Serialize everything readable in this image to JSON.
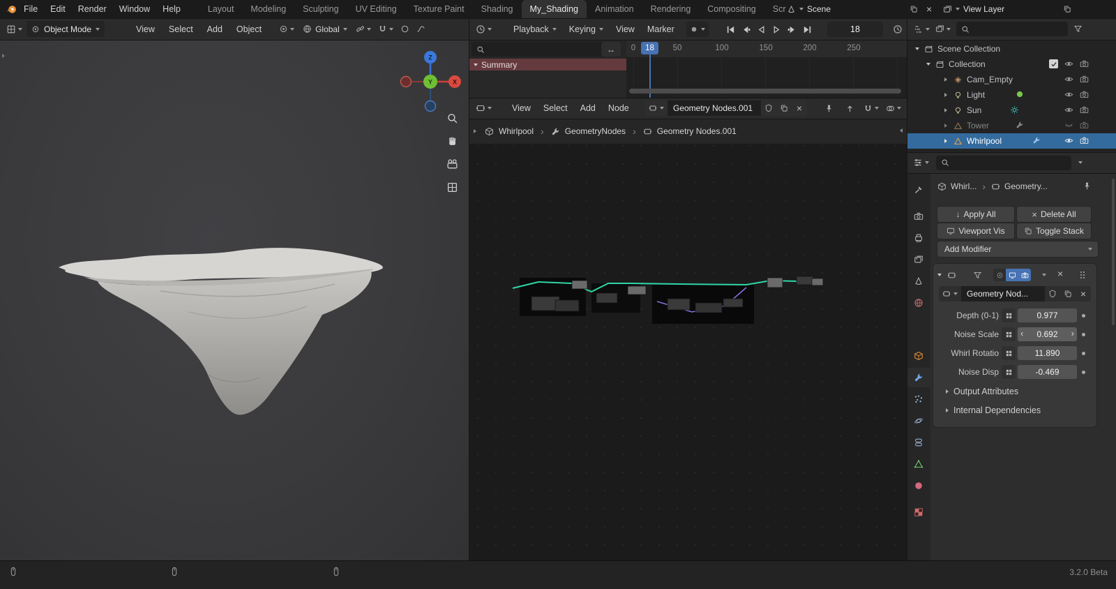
{
  "glyphs": {
    "chevron_right": "›",
    "chevron_left": "‹",
    "close": "×",
    "down_arrow": "↓",
    "swap": "↔"
  },
  "topbar": {
    "menus": [
      "File",
      "Edit",
      "Render",
      "Window",
      "Help"
    ],
    "tabs": [
      "Layout",
      "Modeling",
      "Sculpting",
      "UV Editing",
      "Texture Paint",
      "Shading",
      "My_Shading",
      "Animation",
      "Rendering",
      "Compositing",
      "Scr"
    ],
    "scene": "Scene",
    "view_layer": "View Layer"
  },
  "viewport": {
    "mode": "Object Mode",
    "menus": [
      "View",
      "Select",
      "Add",
      "Object"
    ],
    "orientation": "Global"
  },
  "timeline": {
    "menus": [
      "Playback",
      "Keying",
      "View",
      "Marker"
    ],
    "frame_field": "18",
    "current_frame": "18",
    "summary": "Summary",
    "ticks": [
      "0",
      "50",
      "100",
      "150",
      "200",
      "250"
    ]
  },
  "node_editor": {
    "menus": [
      "View",
      "Select",
      "Add",
      "Node"
    ],
    "datablock": "Geometry Nodes.001",
    "breadcrumb": [
      "Whirlpool",
      "GeometryNodes",
      "Geometry Nodes.001"
    ]
  },
  "outliner": {
    "root": "Scene Collection",
    "collection": "Collection",
    "items": [
      "Cam_Empty",
      "Light",
      "Sun",
      "Tower",
      "Whirlpool"
    ]
  },
  "properties": {
    "path_object": "Whirl...",
    "path_data": "Geometry...",
    "apply_all": "Apply All",
    "delete_all": "Delete All",
    "viewport_vis": "Viewport Vis",
    "toggle_stack": "Toggle Stack",
    "add_modifier": "Add Modifier",
    "modifier_name": "Geometry Nod...",
    "params": [
      {
        "label": "Depth (0-1)",
        "value": "0.977"
      },
      {
        "label": "Noise Scale",
        "value": "0.692"
      },
      {
        "label": "Whirl Rotatio",
        "value": "11.890"
      },
      {
        "label": "Noise Disp",
        "value": "-0.469"
      }
    ],
    "sections": [
      "Output Attributes",
      "Internal Dependencies"
    ]
  },
  "status": {
    "version": "3.2.0 Beta"
  },
  "colors": {
    "accent": "#4772b3",
    "selection": "#336b9e",
    "wire_teal": "#2fd6a6",
    "wire_purple": "#8c6fe0"
  }
}
